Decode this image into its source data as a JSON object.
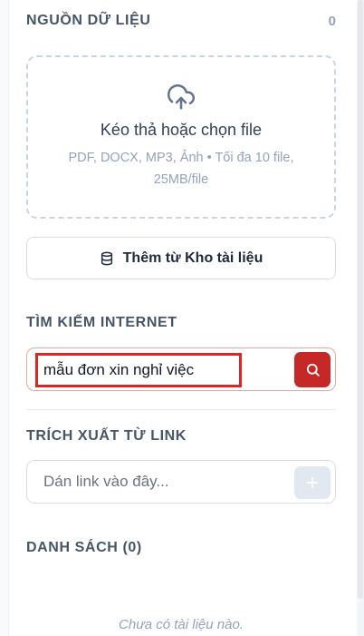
{
  "sources": {
    "title": "NGUỒN DỮ LIỆU",
    "count": "0"
  },
  "dropzone": {
    "title": "Kéo thả hoặc chọn file",
    "subtitle": "PDF, DOCX, MP3, Ảnh • Tối đa 10 file, 25MB/file",
    "icon": "upload-cloud-icon"
  },
  "library_button": {
    "label": "Thêm từ Kho tài liệu",
    "icon": "database-icon"
  },
  "web_search": {
    "title": "TÌM KIẾM INTERNET",
    "value": "mẫu đơn xin nghỉ việc",
    "button_icon": "search-icon",
    "highlight_color": "#e02424",
    "button_color": "#c62828"
  },
  "link_extract": {
    "title": "TRÍCH XUẤT TỪ LINK",
    "placeholder": "Dán link vào đây...",
    "button_icon": "plus-icon"
  },
  "list": {
    "title": "DANH SÁCH (0)",
    "empty_text": "Chưa có tài liệu nào."
  }
}
